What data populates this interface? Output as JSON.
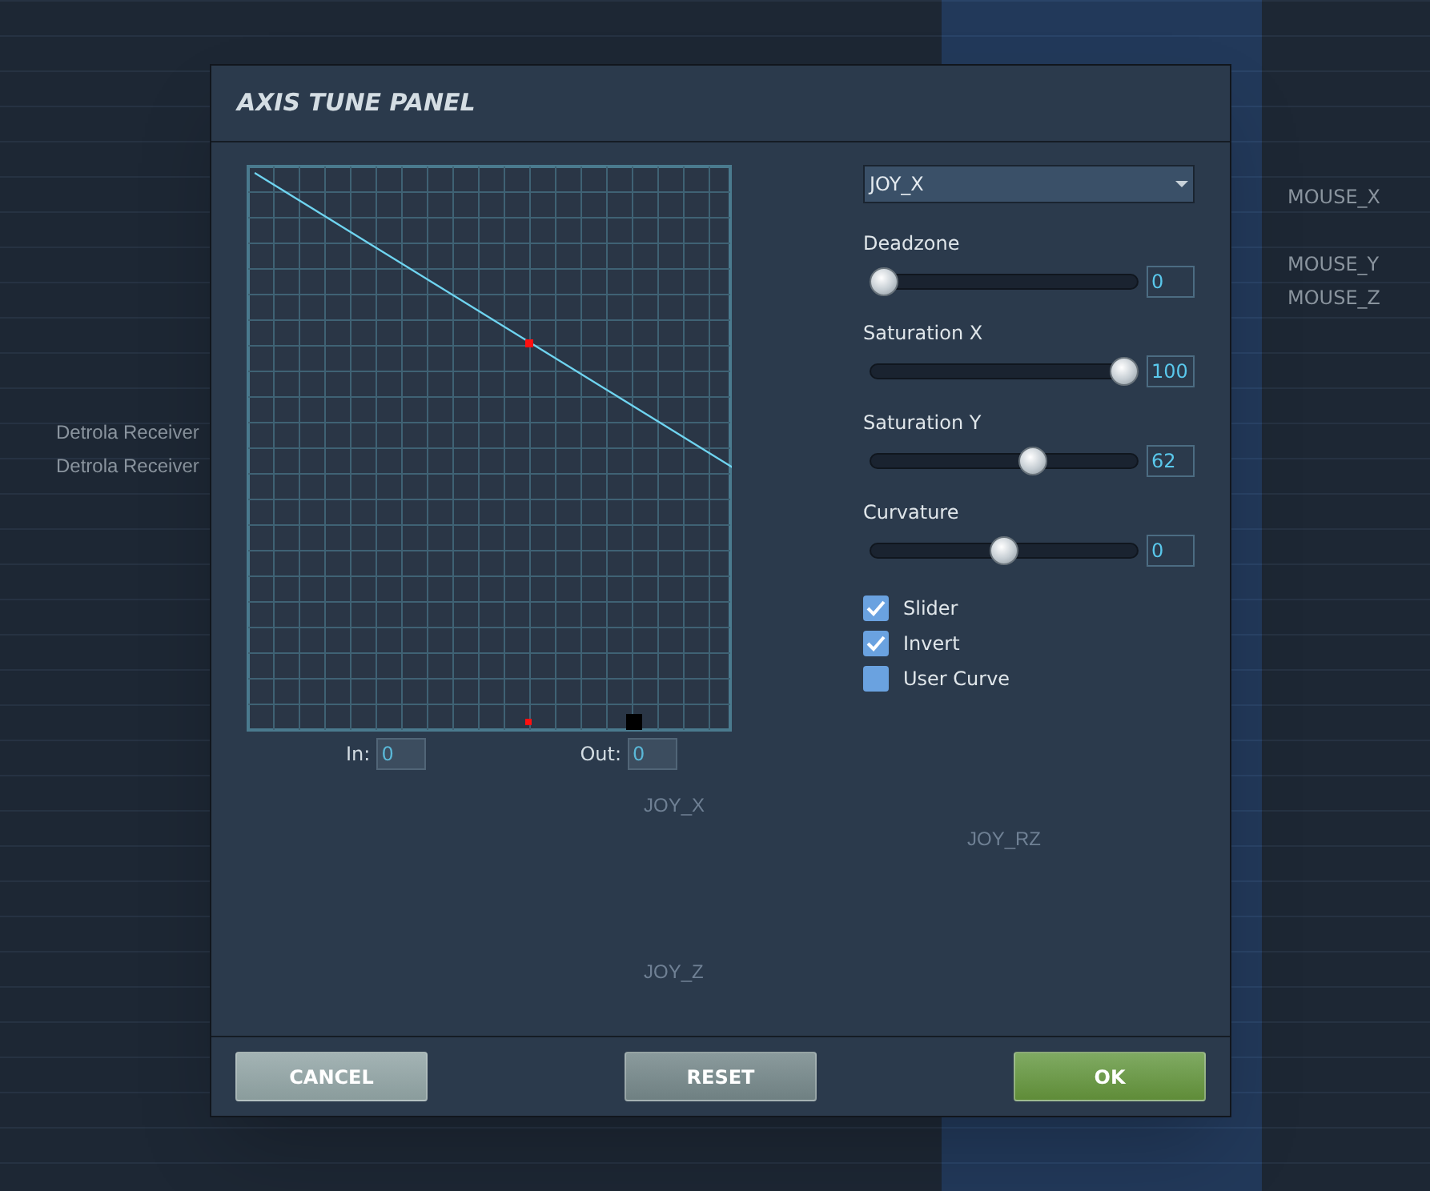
{
  "background": {
    "left_rows": [
      "Detrola Receiver",
      "Detrola Receiver"
    ],
    "right_rows": [
      "MOUSE_X",
      "MOUSE_Y",
      "MOUSE_Z"
    ],
    "behind_dialog": [
      "JOY_X",
      "JOY_RZ",
      "JOY_Z"
    ]
  },
  "dialog": {
    "title": "AXIS TUNE PANEL",
    "in": {
      "label": "In:",
      "value": "0"
    },
    "out": {
      "label": "Out:",
      "value": "0"
    },
    "axis_select": {
      "value": "JOY_X"
    },
    "sliders": [
      {
        "label": "Deadzone",
        "level": 0,
        "value": "0"
      },
      {
        "label": "Saturation X",
        "level": 1,
        "value": "100"
      },
      {
        "label": "Saturation Y",
        "level": 0.62,
        "value": "62"
      },
      {
        "label": "Curvature",
        "level": 0.5,
        "value": "0"
      }
    ],
    "checkboxes": [
      {
        "label": "Slider",
        "checked": true
      },
      {
        "label": "Invert",
        "checked": true
      },
      {
        "label": "User Curve",
        "checked": false
      }
    ],
    "buttons": [
      {
        "label": "CANCEL",
        "kind": "cancel"
      },
      {
        "label": "RESET",
        "kind": "reset"
      },
      {
        "label": "OK",
        "kind": "ok"
      }
    ]
  }
}
